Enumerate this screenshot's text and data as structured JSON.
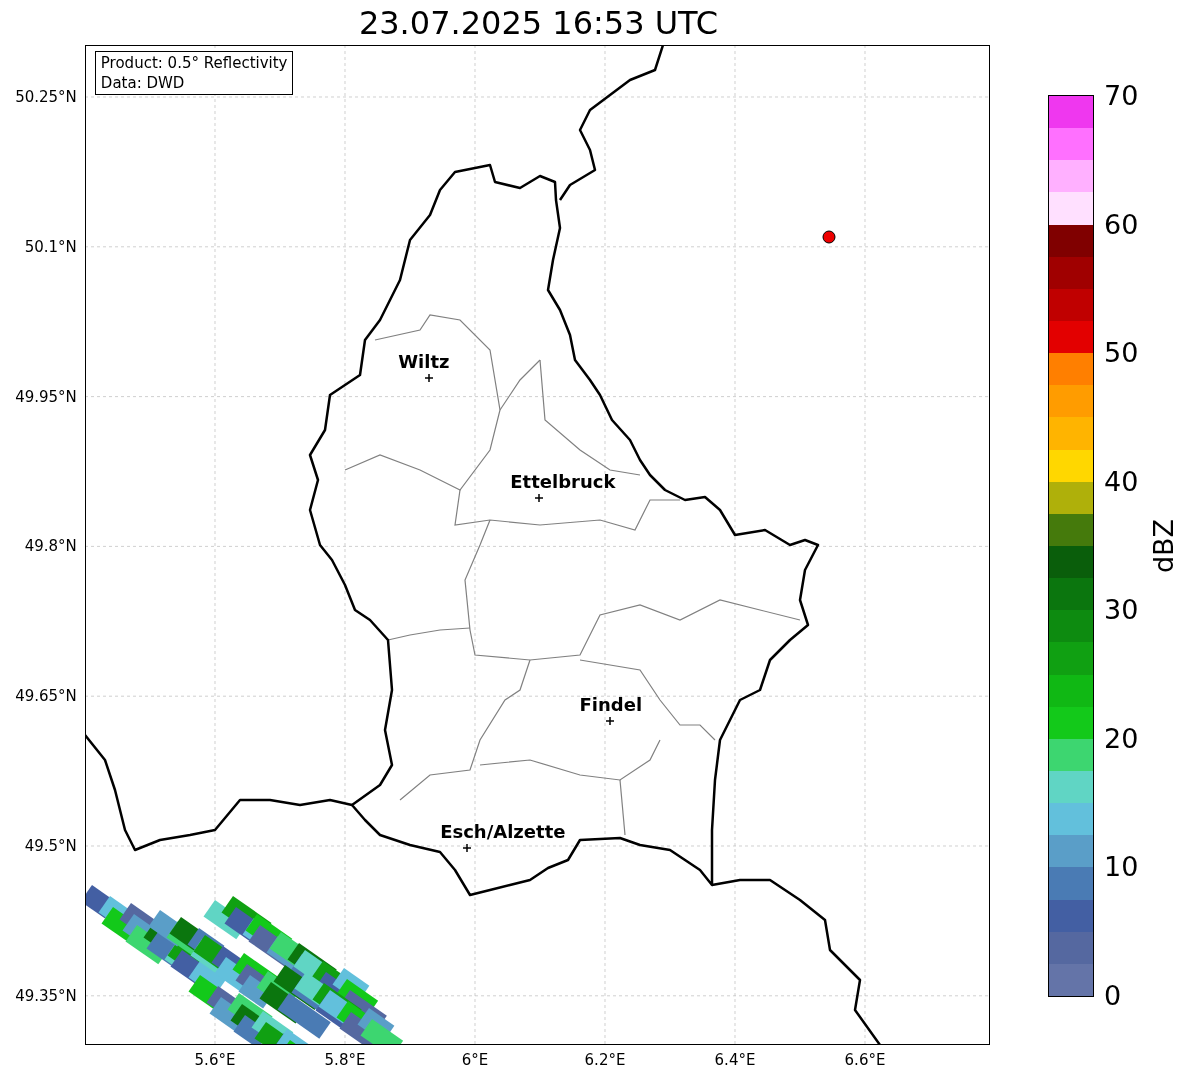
{
  "title": "23.07.2025 16:53 UTC",
  "info_box": [
    "Product: 0.5° Reflectivity",
    "Data: DWD"
  ],
  "map": {
    "y_ticks": [
      "50.25°N",
      "50.1°N",
      "49.95°N",
      "49.8°N",
      "49.65°N",
      "49.5°N",
      "49.35°N"
    ],
    "x_ticks": [
      "5.6°E",
      "5.8°E",
      "6°E",
      "6.2°E",
      "6.4°E",
      "6.6°E"
    ],
    "cities": [
      {
        "name": "Wiltz"
      },
      {
        "name": "Ettelbruck"
      },
      {
        "name": "Findel"
      },
      {
        "name": "Esch/Alzette"
      }
    ]
  },
  "colorbar": {
    "label": "dBZ",
    "ticks": [
      "70",
      "60",
      "50",
      "40",
      "30",
      "20",
      "10",
      "0"
    ],
    "bands": [
      {
        "color": "#ef37ef"
      },
      {
        "color": "#ff70ff"
      },
      {
        "color": "#ffb0ff"
      },
      {
        "color": "#ffe0ff"
      },
      {
        "color": "#800000"
      },
      {
        "color": "#a00000"
      },
      {
        "color": "#c00000"
      },
      {
        "color": "#e30000"
      },
      {
        "color": "#ff7f00"
      },
      {
        "color": "#ff9c00"
      },
      {
        "color": "#ffb400"
      },
      {
        "color": "#ffd700"
      },
      {
        "color": "#afb00a"
      },
      {
        "color": "#457a0c"
      },
      {
        "color": "#0a5e0b"
      },
      {
        "color": "#0b760e"
      },
      {
        "color": "#0d8b10"
      },
      {
        "color": "#10a012"
      },
      {
        "color": "#10b814"
      },
      {
        "color": "#13c91a"
      },
      {
        "color": "#3dd670"
      },
      {
        "color": "#60d5c4"
      },
      {
        "color": "#62c0dc"
      },
      {
        "color": "#5a9ec8"
      },
      {
        "color": "#4a7bb4"
      },
      {
        "color": "#435fa3"
      },
      {
        "color": "#5568a0"
      },
      {
        "color": "#6474a8"
      }
    ]
  }
}
